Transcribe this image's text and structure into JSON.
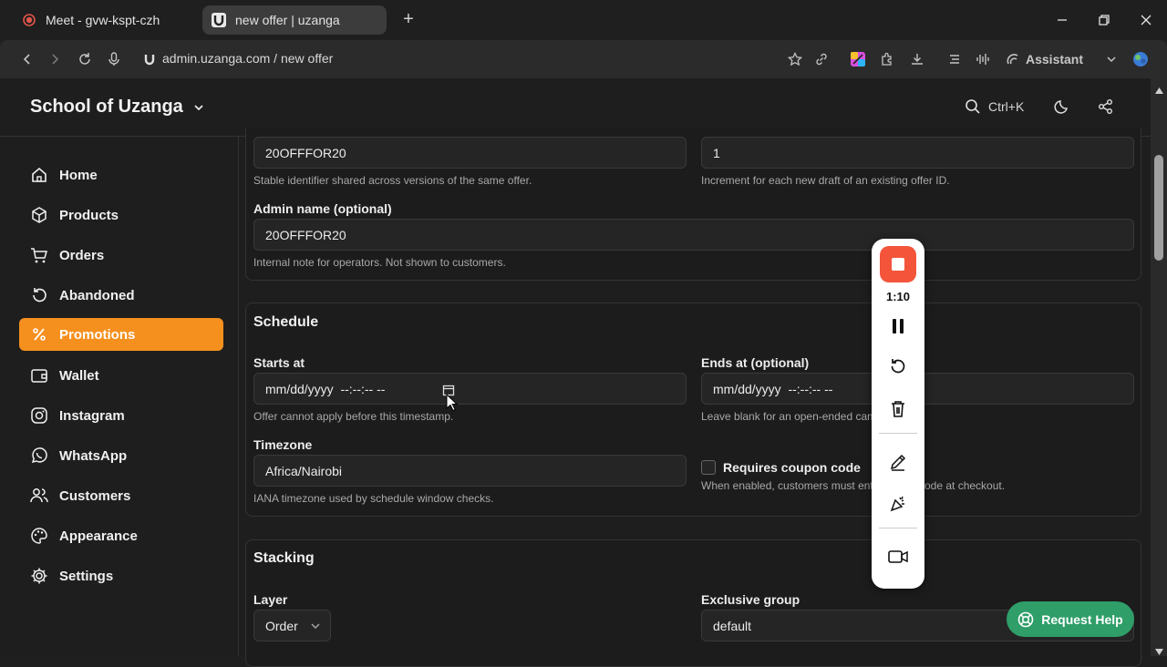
{
  "browser": {
    "tabs": [
      {
        "label": "Meet - gvw-kspt-czh",
        "icon": "record-icon"
      },
      {
        "label": "new offer | uzanga",
        "icon": "uzanga-favicon"
      }
    ],
    "url": "admin.uzanga.com / new offer",
    "assistant_label": "Assistant"
  },
  "app": {
    "brand": "School of Uzanga",
    "search_shortcut": "Ctrl+K",
    "nav": [
      {
        "label": "Home",
        "icon": "home-icon"
      },
      {
        "label": "Products",
        "icon": "box-icon"
      },
      {
        "label": "Orders",
        "icon": "cart-icon"
      },
      {
        "label": "Abandoned",
        "icon": "restore-icon"
      },
      {
        "label": "Promotions",
        "icon": "percent-icon",
        "active": true
      },
      {
        "label": "Wallet",
        "icon": "wallet-icon"
      },
      {
        "label": "Instagram",
        "icon": "instagram-icon"
      },
      {
        "label": "WhatsApp",
        "icon": "whatsapp-icon"
      },
      {
        "label": "Customers",
        "icon": "users-icon"
      },
      {
        "label": "Appearance",
        "icon": "palette-icon"
      },
      {
        "label": "Settings",
        "icon": "gear-icon"
      }
    ]
  },
  "form": {
    "offer_id_value": "20OFFFOR20",
    "offer_id_help": "Stable identifier shared across versions of the same offer.",
    "version_value": "1",
    "version_help": "Increment for each new draft of an existing offer ID.",
    "admin_name_label": "Admin name (optional)",
    "admin_name_value": "20OFFFOR20",
    "admin_name_help": "Internal note for operators. Not shown to customers.",
    "schedule": {
      "title": "Schedule",
      "starts_label": "Starts at",
      "starts_value": "mm/dd/yyyy  --:--:-- --",
      "starts_help": "Offer cannot apply before this timestamp.",
      "ends_label": "Ends at (optional)",
      "ends_value": "mm/dd/yyyy  --:--:-- --",
      "ends_help": "Leave blank for an open-ended cam",
      "timezone_label": "Timezone",
      "timezone_value": "Africa/Nairobi",
      "timezone_help": "IANA timezone used by schedule window checks.",
      "coupon_label": "Requires coupon code",
      "coupon_help_a": "When enabled, customers must ent",
      "coupon_help_b": "ode at checkout."
    },
    "stacking": {
      "title": "Stacking",
      "layer_label": "Layer",
      "layer_value": "Order",
      "group_label": "Exclusive group",
      "group_value": "default"
    }
  },
  "recorder": {
    "time": "1:10"
  },
  "help_button": "Request Help",
  "colors": {
    "accent": "#f5901e",
    "record": "#f4553a",
    "help": "#2f9e69"
  }
}
